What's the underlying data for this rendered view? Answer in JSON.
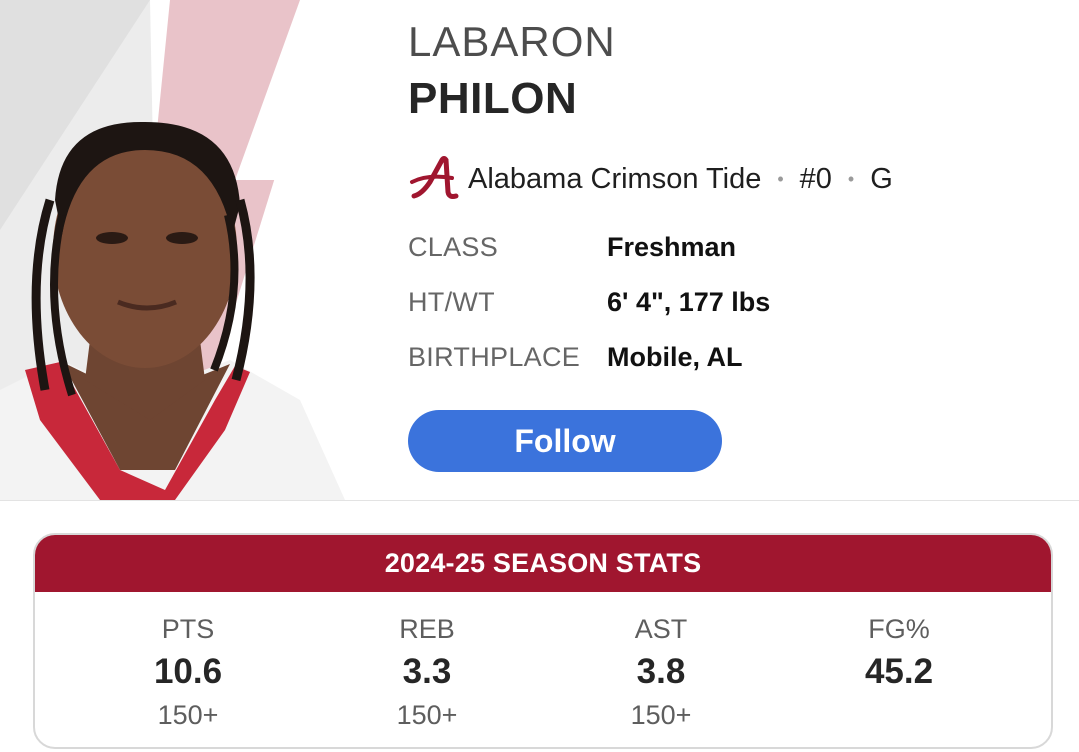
{
  "player": {
    "first_name": "LABARON",
    "last_name": "PHILON"
  },
  "team": {
    "logo_icon": "alabama-script-a-logo",
    "name": "Alabama Crimson Tide",
    "number": "#0",
    "position": "G",
    "separator": "•",
    "color": "#a0162f"
  },
  "bio": [
    {
      "label": "CLASS",
      "value": "Freshman"
    },
    {
      "label": "HT/WT",
      "value": "6' 4\", 177 lbs"
    },
    {
      "label": "BIRTHPLACE",
      "value": "Mobile, AL"
    }
  ],
  "follow_button": {
    "label": "Follow",
    "color": "#3b73dc"
  },
  "season_stats": {
    "title": "2024-25 SEASON STATS",
    "header_color": "#a0162f",
    "stats": [
      {
        "label": "PTS",
        "value": "10.6",
        "rank": "150+"
      },
      {
        "label": "REB",
        "value": "3.3",
        "rank": "150+"
      },
      {
        "label": "AST",
        "value": "3.8",
        "rank": "150+"
      },
      {
        "label": "FG%",
        "value": "45.2",
        "rank": ""
      }
    ]
  }
}
